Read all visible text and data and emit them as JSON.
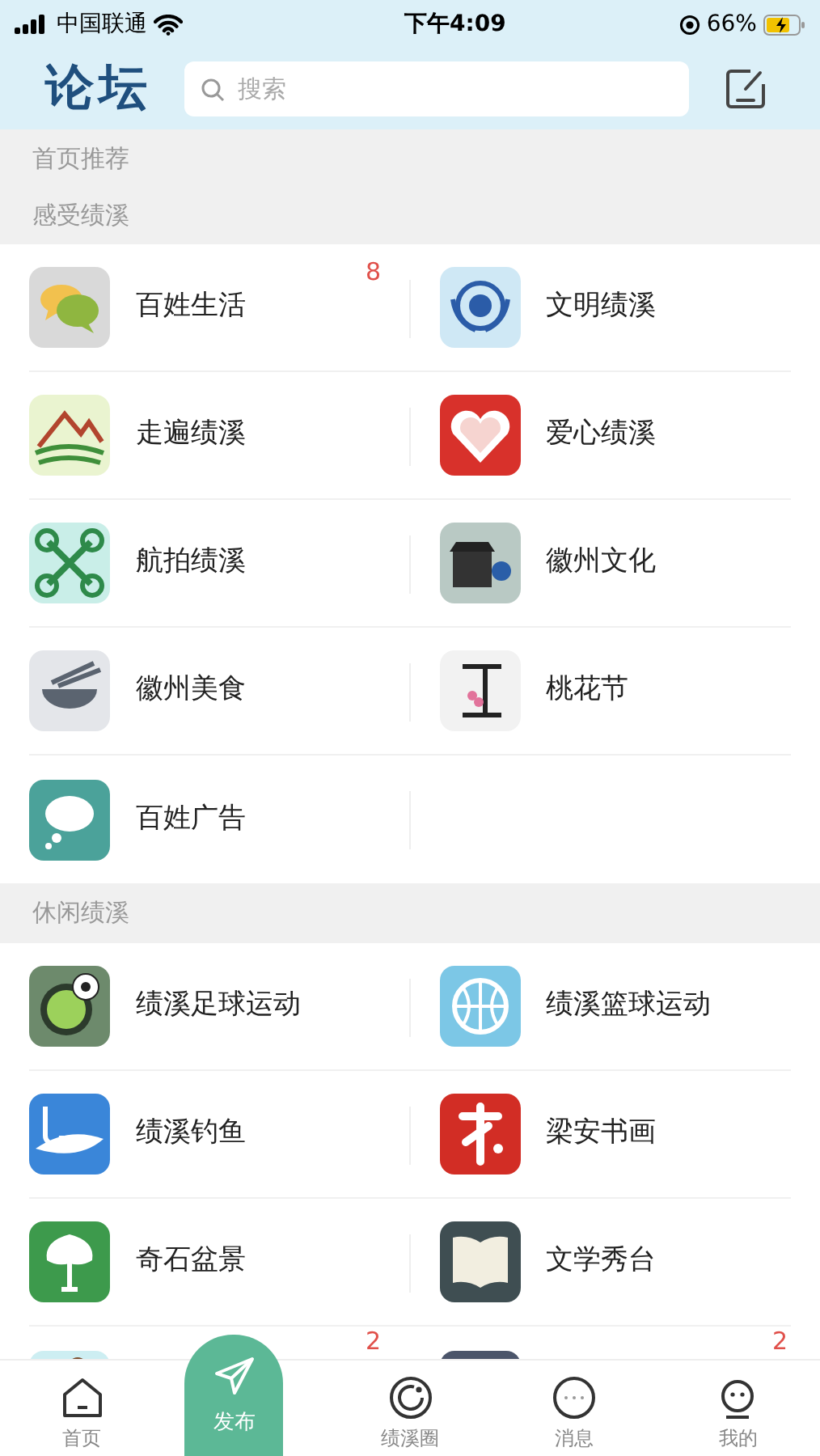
{
  "status_bar": {
    "carrier": "中国联通",
    "time": "下午4:09",
    "battery": "66%"
  },
  "header": {
    "title": "论坛",
    "search": {
      "placeholder": "搜索"
    }
  },
  "sections": [
    {
      "title": "首页推荐"
    },
    {
      "title": "感受绩溪",
      "items": [
        {
          "label": "百姓生活",
          "badge": "8"
        },
        {
          "label": "文明绩溪"
        },
        {
          "label": "走遍绩溪"
        },
        {
          "label": "爱心绩溪"
        },
        {
          "label": "航拍绩溪"
        },
        {
          "label": "徽州文化"
        },
        {
          "label": "徽州美食"
        },
        {
          "label": "桃花节"
        },
        {
          "label": "百姓广告"
        }
      ]
    },
    {
      "title": "休闲绩溪",
      "items": [
        {
          "label": "绩溪足球运动"
        },
        {
          "label": "绩溪篮球运动"
        },
        {
          "label": "绩溪钓鱼"
        },
        {
          "label": "梁安书画"
        },
        {
          "label": "奇石盆景"
        },
        {
          "label": "文学秀台"
        },
        {
          "badge": "2"
        },
        {
          "badge": "2"
        }
      ]
    }
  ],
  "tab_bar": [
    {
      "label": "首页"
    },
    {
      "label": "发布",
      "kind": "publish"
    },
    {
      "label": "绩溪圈"
    },
    {
      "label": "消息"
    },
    {
      "label": "我的"
    }
  ]
}
